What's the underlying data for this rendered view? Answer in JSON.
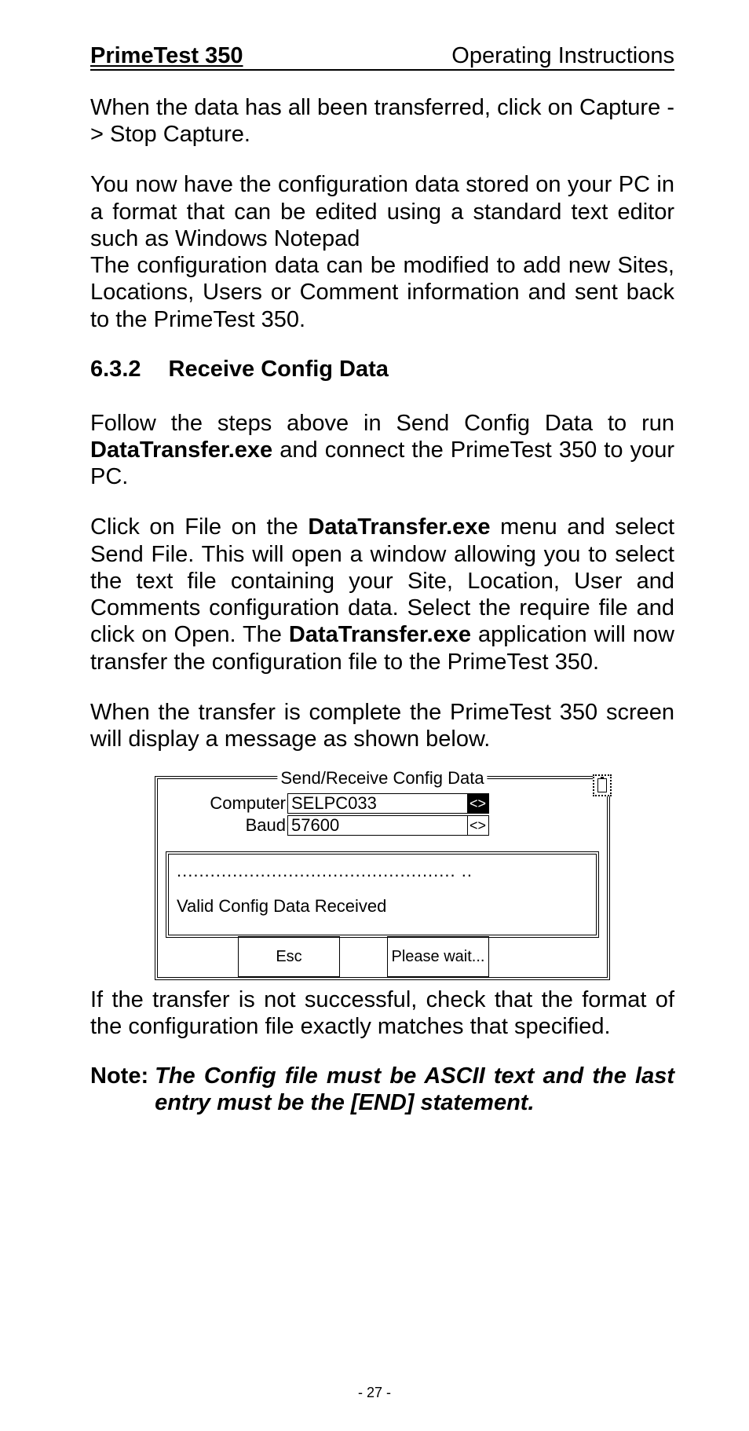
{
  "header": {
    "left": "PrimeTest 350",
    "right": "Operating Instructions"
  },
  "para1": "When the data has all been transferred, click on Capture -> Stop Capture.",
  "para2": "You now have the configuration data stored on your PC in a format that can be edited using a standard text editor such as Windows Notepad",
  "para3": "The configuration data can be modified to add new Sites, Locations, Users or Comment information and sent back to the PrimeTest 350.",
  "section": {
    "num": "6.3.2",
    "title": "Receive Config Data"
  },
  "para4_pre": "Follow the steps above in Send Config Data to run ",
  "para4_bold": "DataTransfer.exe",
  "para4_post": " and connect the PrimeTest 350 to your PC.",
  "para5_a": "Click on File on the ",
  "para5_b": "DataTransfer.exe",
  "para5_c": " menu and select Send File. This will open a window allowing you to select the text file containing your Site, Location, User and Comments configuration data. Select the require file and click on Open. The ",
  "para5_d": "DataTransfer.exe",
  "para5_e": " application will now transfer the configuration file to the PrimeTest 350.",
  "para6": "When the transfer is complete the PrimeTest 350 screen will display a message as shown below.",
  "screen": {
    "title": "Send/Receive Config Data",
    "computer_label": "Computer",
    "computer_value": "SELPC033",
    "baud_label": "Baud",
    "baud_value": "57600",
    "arrow_sym": "<>",
    "dots": ".................................................. ..",
    "status": "Valid Config Data Received",
    "esc": "Esc",
    "wait": "Please wait..."
  },
  "para7": "If the transfer is not successful, check that the format of the configuration file exactly matches that specified.",
  "note": {
    "label": "Note:",
    "body": "The Config file must be ASCII text and the last entry must be the [END] statement."
  },
  "page_num": "- 27 -"
}
